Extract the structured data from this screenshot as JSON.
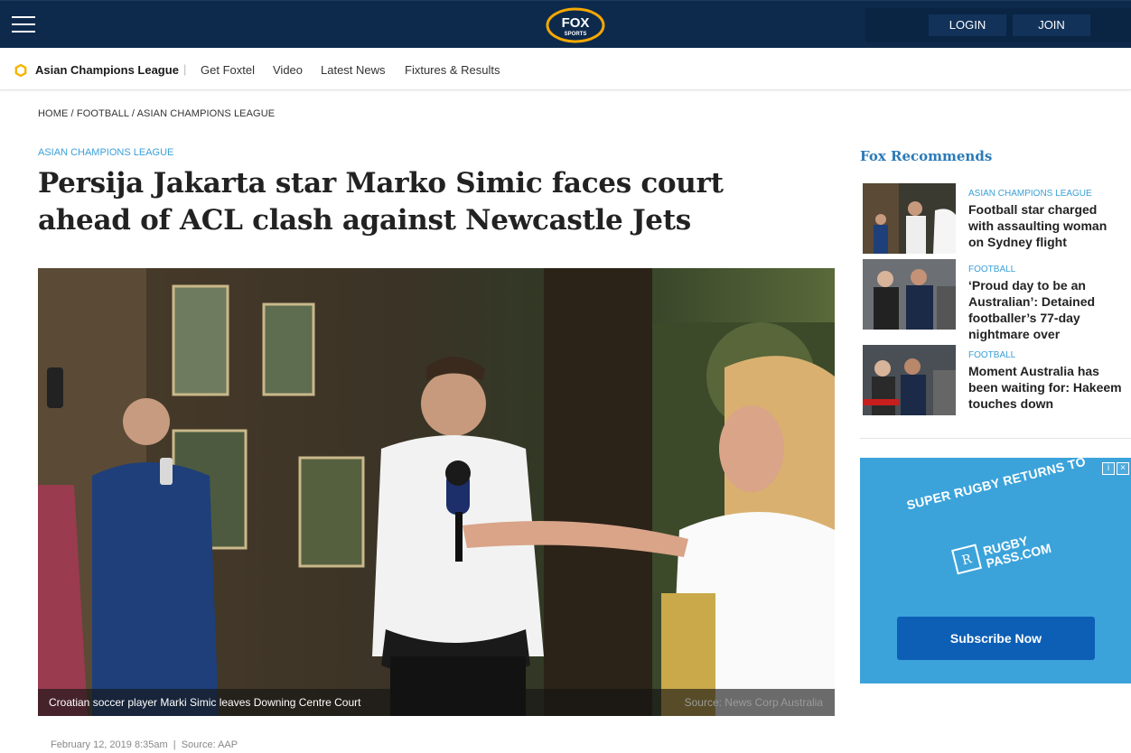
{
  "header": {
    "logo_text": "FOX SPORTS",
    "login_label": "LOGIN",
    "join_label": "JOIN",
    "colors": {
      "bar": "#0d2a4d",
      "logo_gold": "#f5a800",
      "accent_blue": "#3aa0d8"
    }
  },
  "subnav": {
    "brand": "Asian Champions League",
    "separator": "|",
    "links": [
      "Get Foxtel",
      "Video",
      "Latest News",
      "Fixtures & Results"
    ]
  },
  "breadcrumb": {
    "home": "HOME",
    "sep": " / ",
    "football": "FOOTBALL",
    "league": "ASIAN CHAMPIONS LEAGUE"
  },
  "article": {
    "kicker": "ASIAN CHAMPIONS LEAGUE",
    "headline": "Persija Jakarta star Marko Simic faces court ahead of ACL clash against Newcastle Jets",
    "caption": "Croatian soccer player Marki Simic leaves Downing Centre Court",
    "source": "Source: News Corp Australia",
    "meta": "February 12, 2019 8:35am  |  Source: AAP"
  },
  "sidebar": {
    "title": "Fox Recommends",
    "items": [
      {
        "category": "ASIAN CHAMPIONS LEAGUE",
        "title": "Football star charged with assaulting woman on Sydney flight"
      },
      {
        "category": "FOOTBALL",
        "title": "‘Proud day to be an Australian’: Detained footballer’s 77-day nightmare over"
      },
      {
        "category": "FOOTBALL",
        "title": "Moment Australia has been waiting for: Hakeem touches down"
      }
    ]
  },
  "ad": {
    "headline": "SUPER RUGBY RETURNS TO",
    "brand_line1": "RUGBY",
    "brand_line2": "PASS.COM",
    "button": "Subscribe Now",
    "info_icon": "i",
    "close_icon": "×"
  }
}
